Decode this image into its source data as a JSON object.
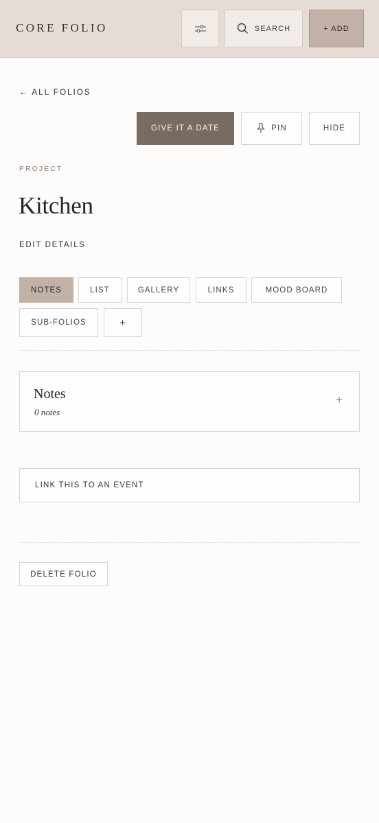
{
  "header": {
    "brand": "CORE FOLIO",
    "search_label": "SEARCH",
    "add_label": "+ ADD"
  },
  "nav": {
    "back_label": "ALL FOLIOS"
  },
  "actions": {
    "date_label": "GIVE IT A DATE",
    "pin_label": "PIN",
    "hide_label": "HIDE"
  },
  "folio": {
    "kicker": "PROJECT",
    "title": "Kitchen",
    "edit_label": "EDIT DETAILS"
  },
  "tabs": [
    {
      "label": "NOTES",
      "active": true
    },
    {
      "label": "LIST",
      "active": false
    },
    {
      "label": "GALLERY",
      "active": false
    },
    {
      "label": "LINKS",
      "active": false
    },
    {
      "label": "MOOD BOARD",
      "active": false
    },
    {
      "label": "SUB-FOLIOS",
      "active": false
    },
    {
      "label": "+",
      "active": false
    }
  ],
  "notes_card": {
    "title": "Notes",
    "subtitle": "0 notes",
    "add_symbol": "+"
  },
  "link_event_label": "LINK THIS TO AN EVENT",
  "delete_label": "DELETE FOLIO",
  "colors": {
    "header_bg": "#e6dcd6",
    "accent_dark": "#7a6b60",
    "accent_tab": "#c1b1a6",
    "page_bg": "#fdfcfa"
  }
}
